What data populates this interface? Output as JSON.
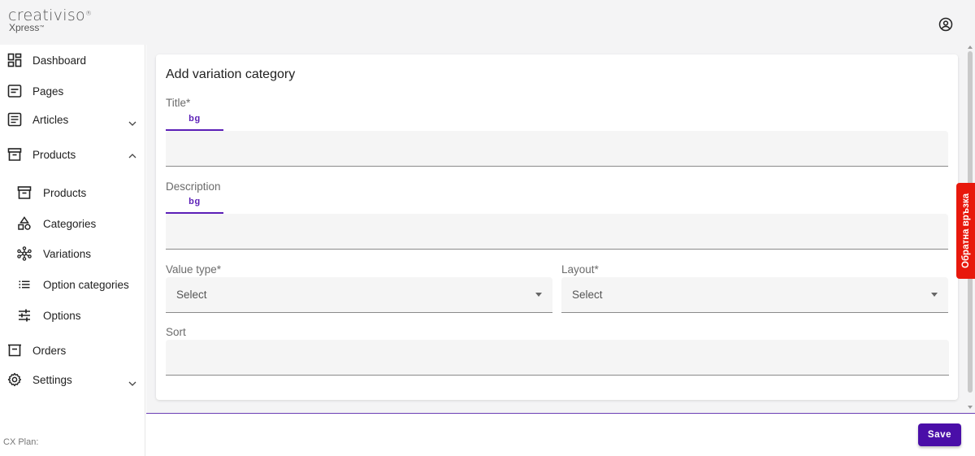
{
  "brand": {
    "name": "creativiso",
    "registered": "®",
    "sub": "Xpress",
    "trademark": "™"
  },
  "header": {
    "account_icon": "account-circle-icon"
  },
  "sidebar": {
    "items": [
      {
        "label": "Dashboard",
        "icon": "dashboard-icon"
      },
      {
        "label": "Pages",
        "icon": "pages-icon"
      },
      {
        "label": "Articles",
        "icon": "articles-icon",
        "expanded": false
      },
      {
        "label": "Products",
        "icon": "archive-icon",
        "expanded": true
      },
      {
        "label": "Orders",
        "icon": "orders-icon"
      },
      {
        "label": "Settings",
        "icon": "gear-icon",
        "expanded": false
      }
    ],
    "sub_items": [
      {
        "label": "Products",
        "icon": "archive-icon"
      },
      {
        "label": "Categories",
        "icon": "categories-icon"
      },
      {
        "label": "Variations",
        "icon": "variations-icon"
      },
      {
        "label": "Option categories",
        "icon": "list-icon"
      },
      {
        "label": "Options",
        "icon": "tune-icon"
      }
    ],
    "plan_label": "CX Plan:"
  },
  "form": {
    "title": "Add variation category",
    "title_field": {
      "label": "Title*",
      "lang_tab": "bg",
      "value": ""
    },
    "description_field": {
      "label": "Description",
      "lang_tab": "bg",
      "value": ""
    },
    "value_type": {
      "label": "Value type*",
      "selected": "Select"
    },
    "layout": {
      "label": "Layout*",
      "selected": "Select"
    },
    "sort": {
      "label": "Sort",
      "value": ""
    }
  },
  "footer": {
    "save_label": "Save"
  },
  "feedback": {
    "label": "Обратна връзка"
  },
  "colors": {
    "accent": "#4a0ea8",
    "tab_accent": "#5b1fb7",
    "feedback": "#e8180c",
    "background": "#f4f4f5"
  }
}
